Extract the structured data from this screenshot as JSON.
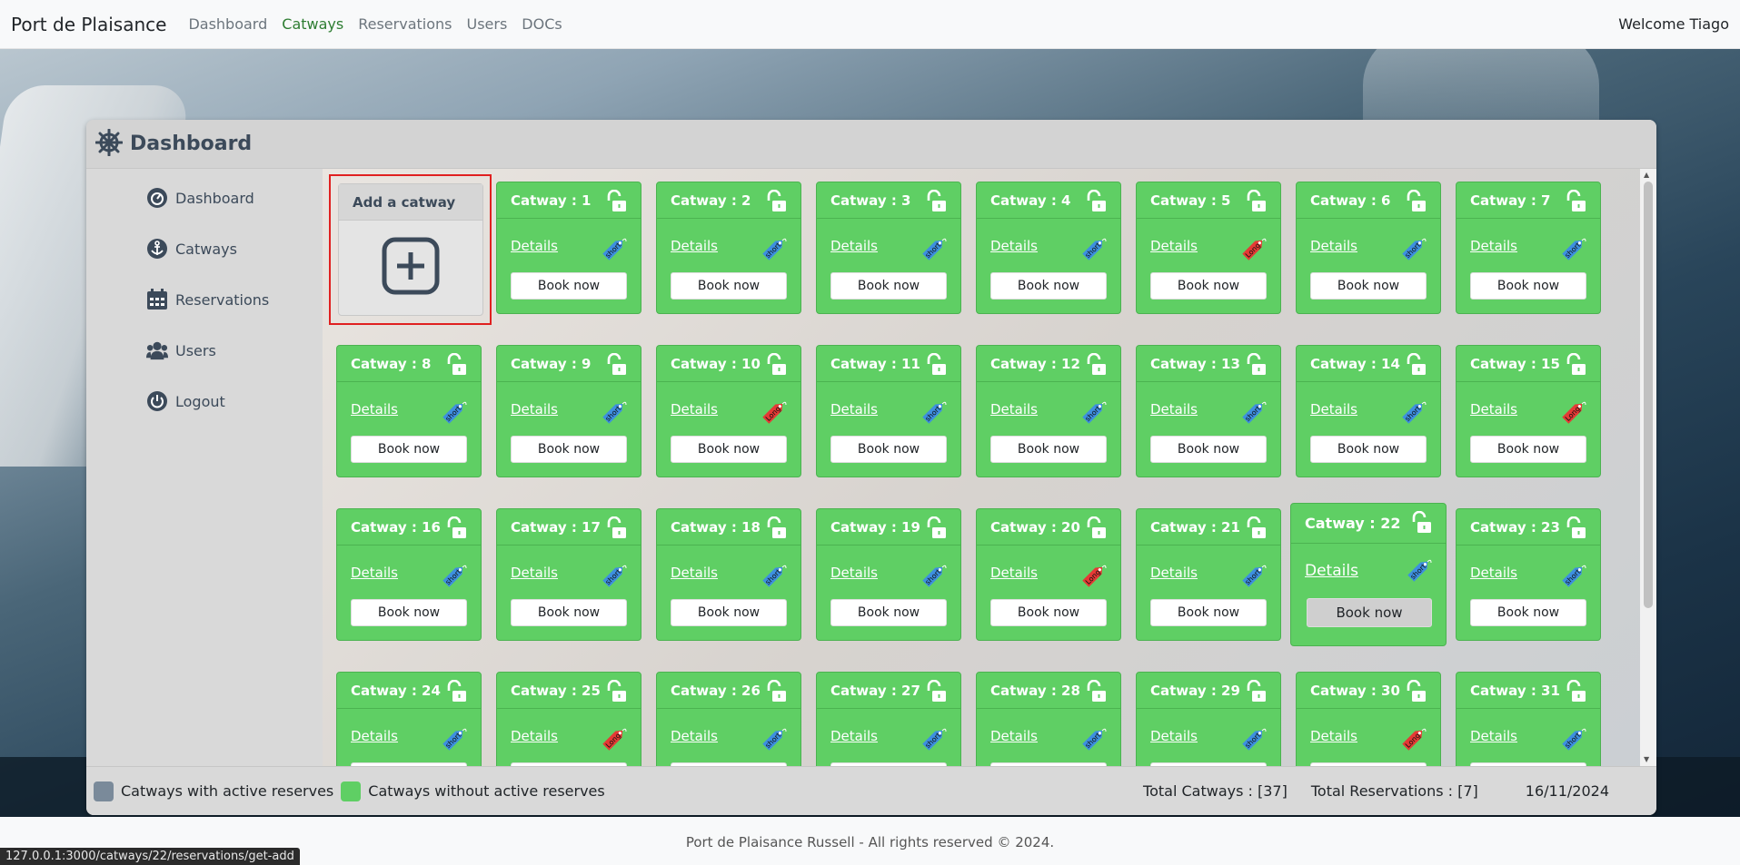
{
  "navbar": {
    "brand": "Port de Plaisance",
    "links": [
      "Dashboard",
      "Catways",
      "Reservations",
      "Users",
      "DOCs"
    ],
    "active": "Catways",
    "welcome": "Welcome Tiago"
  },
  "panel": {
    "title": "Dashboard",
    "sidebar": [
      {
        "label": "Dashboard",
        "icon": "dashboard-gauge-icon"
      },
      {
        "label": "Catways",
        "icon": "anchor-icon"
      },
      {
        "label": "Reservations",
        "icon": "calendar-icon"
      },
      {
        "label": "Users",
        "icon": "users-icon"
      },
      {
        "label": "Logout",
        "icon": "power-icon"
      }
    ],
    "add_card": {
      "title": "Add a catway"
    },
    "card_labels": {
      "details": "Details",
      "book": "Book now"
    },
    "catways": [
      {
        "name": "Catway : 1",
        "type": "short"
      },
      {
        "name": "Catway : 2",
        "type": "short"
      },
      {
        "name": "Catway : 3",
        "type": "short"
      },
      {
        "name": "Catway : 4",
        "type": "short"
      },
      {
        "name": "Catway : 5",
        "type": "Long"
      },
      {
        "name": "Catway : 6",
        "type": "short"
      },
      {
        "name": "Catway : 7",
        "type": "short"
      },
      {
        "name": "Catway : 8",
        "type": "short"
      },
      {
        "name": "Catway : 9",
        "type": "short"
      },
      {
        "name": "Catway : 10",
        "type": "Long"
      },
      {
        "name": "Catway : 11",
        "type": "short"
      },
      {
        "name": "Catway : 12",
        "type": "short"
      },
      {
        "name": "Catway : 13",
        "type": "short"
      },
      {
        "name": "Catway : 14",
        "type": "short"
      },
      {
        "name": "Catway : 15",
        "type": "Long"
      },
      {
        "name": "Catway : 16",
        "type": "short"
      },
      {
        "name": "Catway : 17",
        "type": "short"
      },
      {
        "name": "Catway : 18",
        "type": "short"
      },
      {
        "name": "Catway : 19",
        "type": "short"
      },
      {
        "name": "Catway : 20",
        "type": "Long"
      },
      {
        "name": "Catway : 21",
        "type": "short"
      },
      {
        "name": "Catway : 22",
        "type": "short"
      },
      {
        "name": "Catway : 23",
        "type": "short"
      },
      {
        "name": "Catway : 24",
        "type": "short"
      },
      {
        "name": "Catway : 25",
        "type": "Long"
      },
      {
        "name": "Catway : 26",
        "type": "short"
      },
      {
        "name": "Catway : 27",
        "type": "short"
      },
      {
        "name": "Catway : 28",
        "type": "short"
      },
      {
        "name": "Catway : 29",
        "type": "short"
      },
      {
        "name": "Catway : 30",
        "type": "Long"
      },
      {
        "name": "Catway : 31",
        "type": "short"
      }
    ],
    "hovered_catway": "Catway : 22",
    "legend": {
      "active_label": "Catways with active reserves",
      "inactive_label": "Catways without active reserves",
      "total_catways": "Total Catways : [37]",
      "total_reservations": "Total Reservations : [7]",
      "date": "16/11/2024"
    }
  },
  "colors": {
    "card_green": "#5fcf64",
    "active_swatch": "#7a8a9a",
    "tag_short": "#3d8fe0",
    "tag_long": "#e53935",
    "highlight": "#e02020"
  },
  "footer": {
    "text": "Port de Plaisance Russell - All rights reserved © 2024."
  },
  "status_bar": {
    "url": "127.0.0.1:3000/catways/22/reservations/get-add"
  }
}
